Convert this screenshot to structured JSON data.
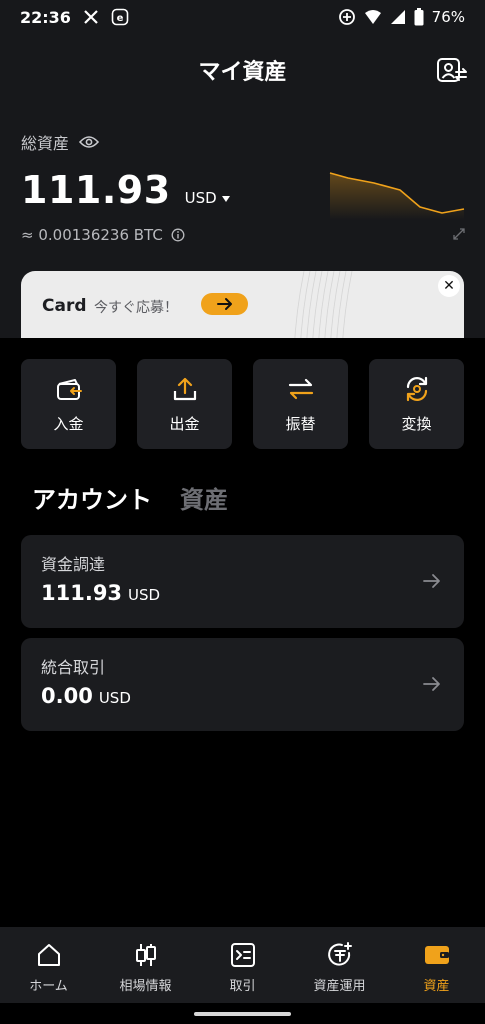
{
  "status_bar": {
    "time": "22:36",
    "battery": "76%",
    "icons": [
      "x-logo-icon",
      "e-app-icon",
      "data-saver-icon",
      "wifi-icon",
      "signal-icon",
      "battery-icon"
    ]
  },
  "header": {
    "title": "マイ資産",
    "profile_icon": "profile-switch-icon"
  },
  "summary": {
    "label": "総資産",
    "balance": "111.93",
    "currency": "USD",
    "btc_equivalent": "≈ 0.00136236 BTC",
    "sparkline_color": "#f0a21b"
  },
  "banner": {
    "title": "Card",
    "subtitle": "今すぐ応募！",
    "accent_color": "#f0a21b"
  },
  "actions": [
    {
      "label": "入金",
      "icon": "deposit-icon"
    },
    {
      "label": "出金",
      "icon": "withdraw-icon"
    },
    {
      "label": "振替",
      "icon": "transfer-icon"
    },
    {
      "label": "変換",
      "icon": "convert-icon"
    }
  ],
  "tabs": [
    {
      "label": "アカウント",
      "active": true
    },
    {
      "label": "資産",
      "active": false
    }
  ],
  "accounts": [
    {
      "name": "資金調達",
      "amount": "111.93",
      "unit": "USD"
    },
    {
      "name": "統合取引",
      "amount": "0.00",
      "unit": "USD"
    }
  ],
  "bottom_nav": [
    {
      "label": "ホーム",
      "icon": "home-icon",
      "active": false
    },
    {
      "label": "相場情報",
      "icon": "candlestick-icon",
      "active": false
    },
    {
      "label": "取引",
      "icon": "trade-icon",
      "active": false
    },
    {
      "label": "資産運用",
      "icon": "earn-icon",
      "active": false
    },
    {
      "label": "資産",
      "icon": "wallet-icon",
      "active": true
    }
  ],
  "colors": {
    "accent": "#f0a21b",
    "background_top": "#17181b",
    "surface": "#1f2024"
  }
}
